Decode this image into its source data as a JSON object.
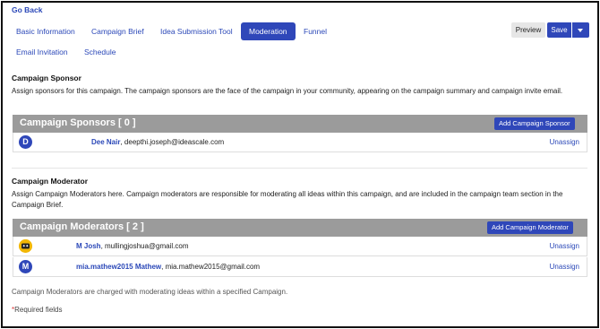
{
  "nav": {
    "go_back": "Go Back"
  },
  "tabs": [
    {
      "label": "Basic Information"
    },
    {
      "label": "Campaign Brief"
    },
    {
      "label": "Idea Submission Tool"
    },
    {
      "label": "Moderation",
      "active": true
    },
    {
      "label": "Funnel"
    },
    {
      "label": "Email Invitation"
    },
    {
      "label": "Schedule"
    }
  ],
  "toolbar": {
    "preview": "Preview",
    "save": "Save"
  },
  "sponsor": {
    "heading": "Campaign Sponsor",
    "description": "Assign sponsors for this campaign. The campaign sponsors are the face of the campaign in your community, appearing on the campaign summary and campaign invite email.",
    "panel_title": "Campaign Sponsors [ 0 ]",
    "add_button": "Add Campaign Sponsor",
    "members": [
      {
        "initial": "D",
        "name": "Dee Nair",
        "email": ", deepthi.joseph@ideascale.com",
        "action": "Unassign"
      }
    ]
  },
  "moderator": {
    "heading": "Campaign Moderator",
    "description": "Assign Campaign Moderators here. Campaign moderators are responsible for moderating all ideas within this campaign, and are included in the campaign team section in the Campaign Brief.",
    "panel_title": "Campaign Moderators [ 2 ]",
    "add_button": "Add Campaign Moderator",
    "members": [
      {
        "initial": "",
        "name": "M Josh",
        "email": ", mullingjoshua@gmail.com",
        "action": "Unassign"
      },
      {
        "initial": "M",
        "name": "mia.mathew2015 Mathew",
        "email": ", mia.mathew2015@gmail.com",
        "action": "Unassign"
      }
    ]
  },
  "footer": {
    "note": "Campaign Moderators are charged with moderating ideas within a specified Campaign.",
    "required_star": "*",
    "required_text": "Required fields"
  },
  "colors": {
    "accent": "#2f47b9",
    "panel_header": "#9b9b9b"
  }
}
